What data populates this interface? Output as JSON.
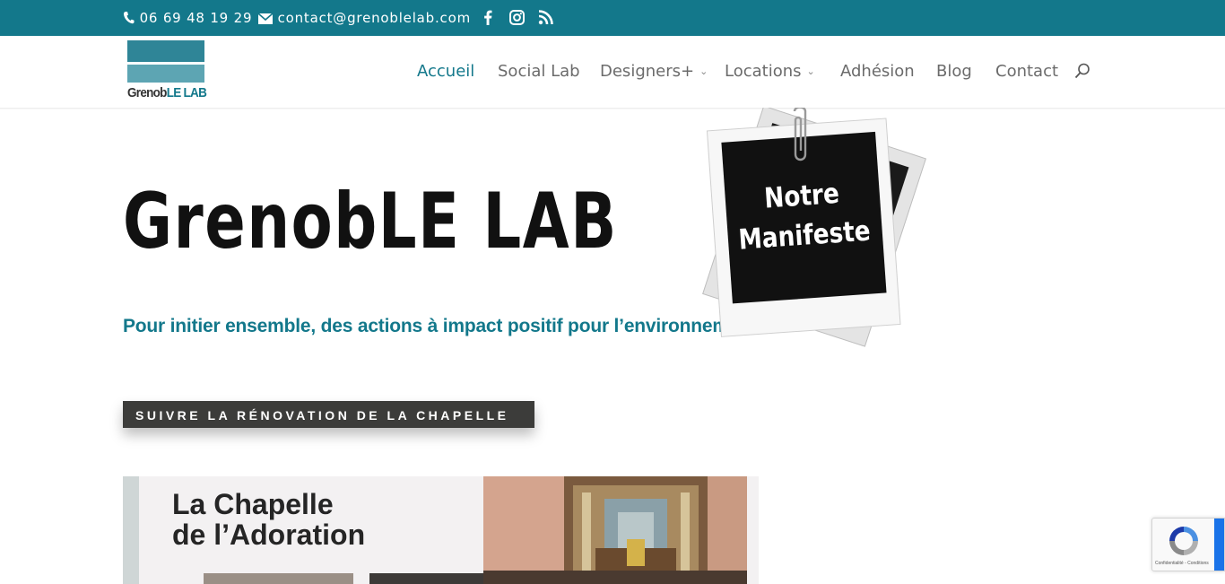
{
  "topbar": {
    "phone": "06 69 48 19 29",
    "email": "contact@grenoblelab.com",
    "social": [
      "facebook-icon",
      "instagram-icon",
      "rss-icon"
    ]
  },
  "header": {
    "logo": {
      "left": "Grenob",
      "right": "LE LAB"
    },
    "nav": [
      {
        "label": "Accueil",
        "active": true
      },
      {
        "label": "Social Lab"
      },
      {
        "label": "Designers+",
        "dropdown": true
      },
      {
        "label": "Locations",
        "dropdown": true
      },
      {
        "label": "Adhésion"
      },
      {
        "label": "Blog"
      },
      {
        "label": "Contact"
      }
    ]
  },
  "hero": {
    "title": "GrenobLE LAB",
    "subtitle": "Pour initier ensemble, des actions à impact positif pour l’environnement",
    "cta_label": "SUIVRE LA RÉNOVATION DE LA CHAPELLE",
    "polaroid": {
      "line1": "Notre",
      "line2": "Manifeste"
    }
  },
  "chapel": {
    "line1": "La Chapelle",
    "line2": "de l’Adoration"
  },
  "recaptcha": {
    "fine_print": "Confidentialité - Conditions"
  },
  "colors": {
    "brand": "#13788b",
    "cta_bg": "#3c3c3a",
    "title": "#111111"
  }
}
